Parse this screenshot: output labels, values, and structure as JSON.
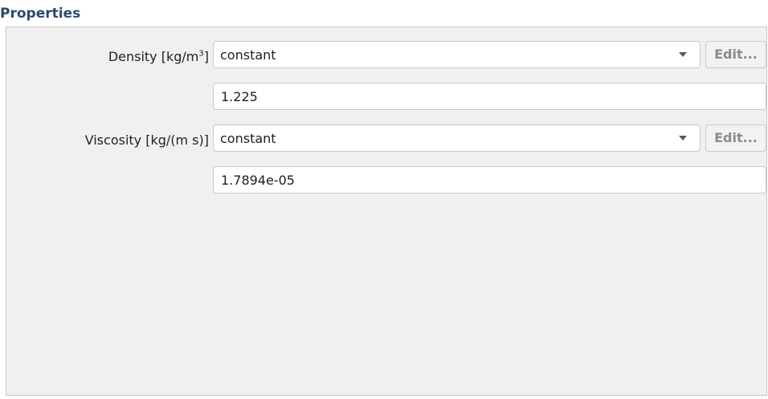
{
  "panel": {
    "title": "Properties"
  },
  "density": {
    "label_prefix": "Density [kg/m",
    "label_sup": "3",
    "label_suffix": "]",
    "method": "constant",
    "edit_label": "Edit...",
    "value": "1.225"
  },
  "viscosity": {
    "label": "Viscosity [kg/(m s)]",
    "method": "constant",
    "edit_label": "Edit...",
    "value": "1.7894e-05"
  },
  "icons": {
    "dropdown": "chevron-down-icon"
  }
}
